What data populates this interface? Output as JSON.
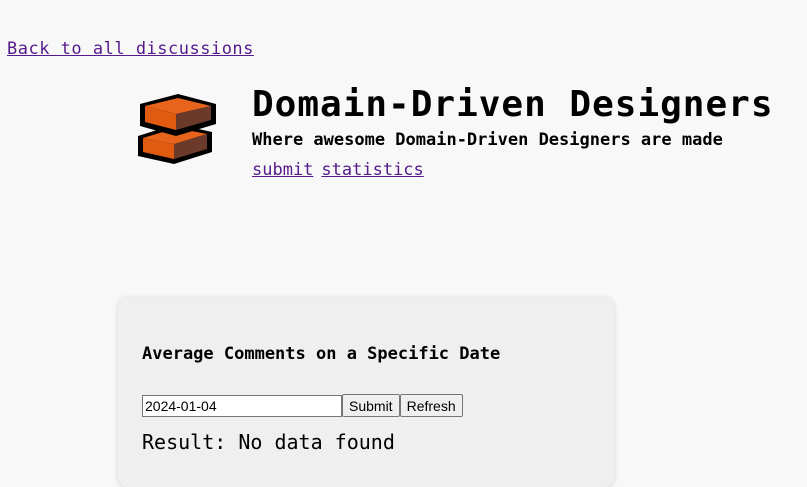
{
  "nav": {
    "back_link": "Back to all discussions",
    "submit_link": "submit",
    "statistics_link": "statistics"
  },
  "header": {
    "title": "Domain-Driven Designers",
    "tagline": "Where awesome Domain-Driven Designers are made",
    "logo_icon": "brick-stack-icon"
  },
  "stats_card": {
    "title": "Average Comments on a Specific Date",
    "date_value": "2024-01-04",
    "submit_label": "Submit",
    "refresh_label": "Refresh",
    "result_text": "Result: No data found"
  },
  "colors": {
    "background": "#f8f8f8",
    "card_background": "#efefef",
    "link": "#551a8b",
    "brick_orange": "#e8641c",
    "brick_dark": "#6b3a2a"
  }
}
